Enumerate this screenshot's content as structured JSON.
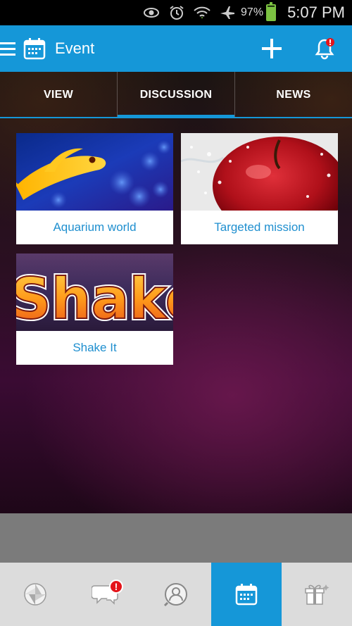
{
  "status_bar": {
    "battery_percent": "97%",
    "time": "5:07 PM"
  },
  "app_bar": {
    "title": "Event",
    "icons": [
      "menu-icon",
      "calendar-icon",
      "add-icon",
      "bell-icon"
    ]
  },
  "tabs": [
    {
      "label": "VIEW"
    },
    {
      "label": "DISCUSSION",
      "active": true
    },
    {
      "label": "NEWS"
    }
  ],
  "cards": [
    {
      "title": "Aquarium world",
      "image": "fish-image"
    },
    {
      "title": "Targeted mission",
      "image": "apple-image"
    },
    {
      "title": "Shake It",
      "image": "shake-image"
    }
  ],
  "shake_art_text": "Shake",
  "bottom_nav": {
    "items": [
      {
        "icon": "aperture-icon"
      },
      {
        "icon": "chat-icon",
        "badge": "!"
      },
      {
        "icon": "profile-icon"
      },
      {
        "icon": "calendar-icon",
        "active": true
      },
      {
        "icon": "gift-icon"
      }
    ]
  },
  "colors": {
    "accent": "#1597d8",
    "card_text": "#1f8fcf",
    "badge": "#e4141a"
  }
}
